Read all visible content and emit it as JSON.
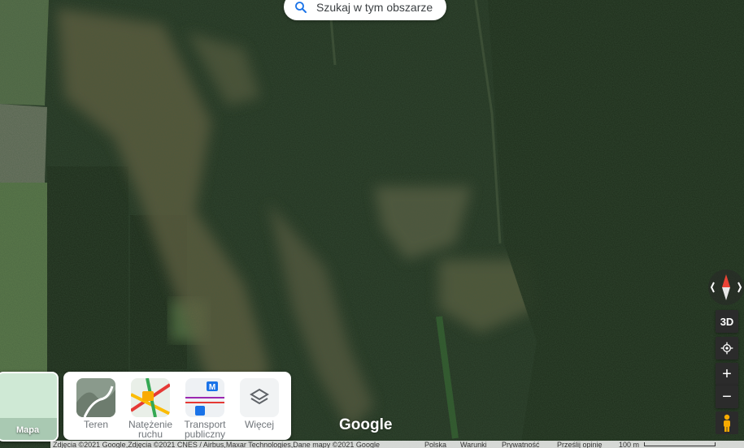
{
  "search": {
    "label": "Szukaj w tym obszarze",
    "icon": "search-icon"
  },
  "map_controls": {
    "btn3d": "3D",
    "zoom_in": "+",
    "zoom_out": "−",
    "compass_icon": "compass-icon",
    "locate_icon": "my-location-icon",
    "pegman_icon": "pegman-icon"
  },
  "basemap_tile": {
    "label": "Mapa"
  },
  "layers": [
    {
      "label_line1": "Teren",
      "label_line2": ""
    },
    {
      "label_line1": "Natężenie",
      "label_line2": "ruchu"
    },
    {
      "label_line1": "Transport",
      "label_line2": "publiczny"
    },
    {
      "label_line1": "Więcej",
      "label_line2": ""
    }
  ],
  "branding": {
    "logo": "Google"
  },
  "footer": {
    "attribution": "Zdjęcia ©2021 Google,Zdjęcia ©2021 CNES / Airbus,Maxar Technologies,Dane mapy ©2021 Google",
    "country": "Polska",
    "terms": "Warunki",
    "privacy": "Prywatność",
    "feedback": "Prześlij opinię",
    "scale": "100 m"
  },
  "colors": {
    "forest_dark": "#1f2d1c",
    "accent_blue": "#1a73e8",
    "compass_red": "#ea4335"
  }
}
